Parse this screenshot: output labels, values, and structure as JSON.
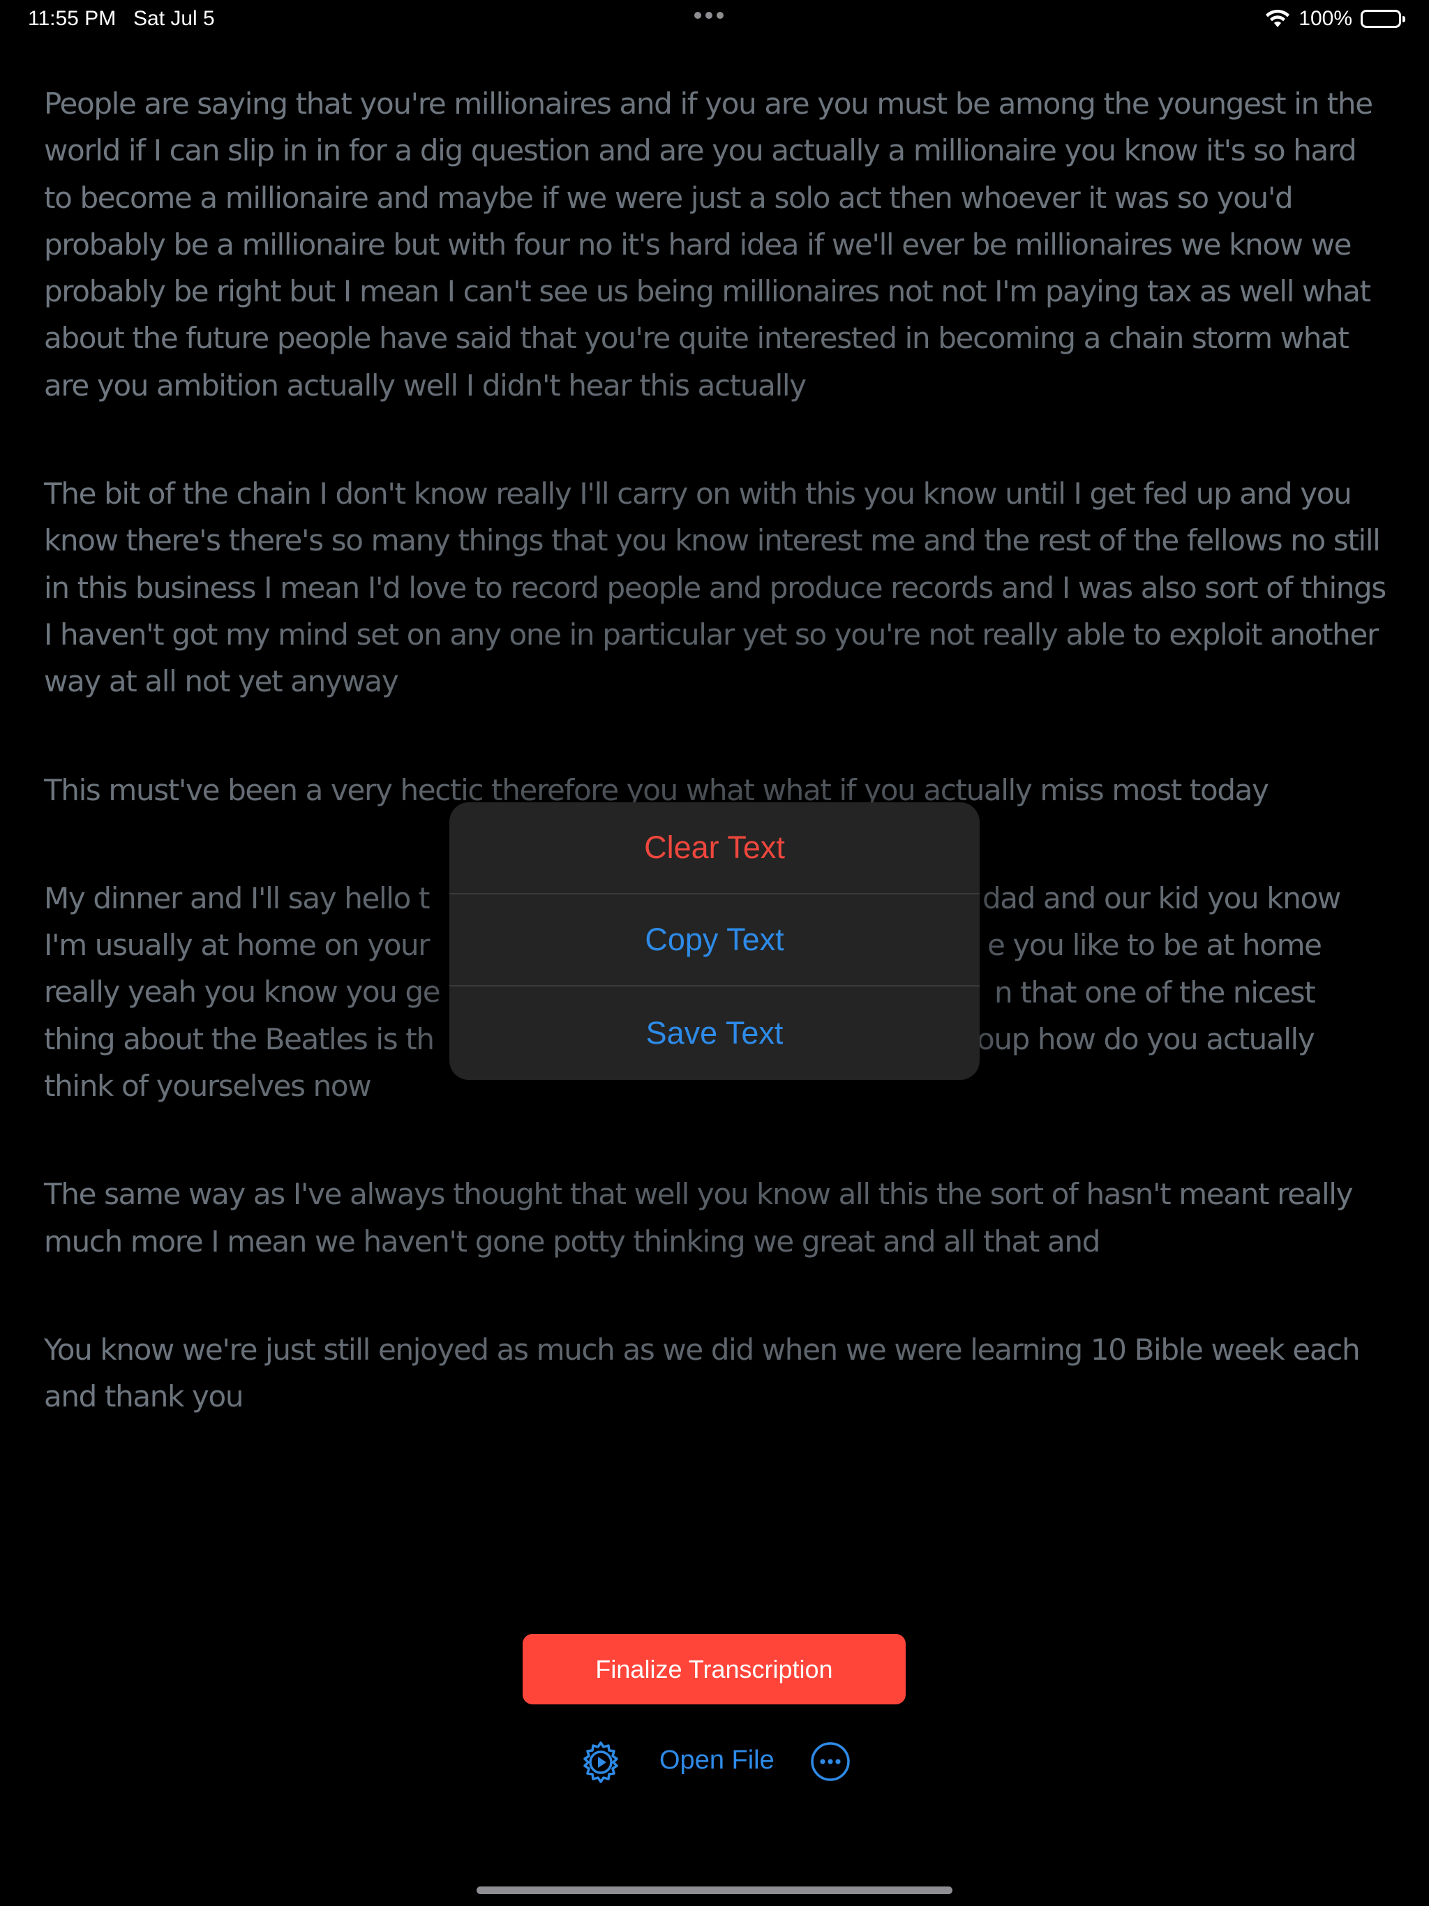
{
  "status_bar": {
    "time": "11:55 PM",
    "date": "Sat Jul 5",
    "battery": "100%",
    "wifi_icon": "wifi-icon",
    "battery_icon": "battery-full-icon"
  },
  "transcript": {
    "paragraphs": [
      "People are saying that you're millionaires and if you are you must be among the youngest in the world if I can slip in in for a dig question and are you actually a millionaire you know it's so hard to become a millionaire and maybe if we were just a solo act then whoever it was so you'd probably be a millionaire but with four no it's hard idea if we'll ever be millionaires we know we probably be right but I mean I can't see us being millionaires not not I'm paying tax as well what about the future people have said that you're quite interested in becoming a chain storm what are you ambition actually well I didn't hear this actually",
      " The bit of the chain I don't know really I'll carry on with this you know until I get fed up and you know there's there's so many things that you know interest me and the rest of the fellows no still in this business I mean I'd love to record people and produce records and I was also sort of things I haven't got my mind set on any one in particular yet so you're not really able to exploit another way at all not yet anyway",
      " This must've been a very hectic therefore you what what if you actually miss most today",
      " My dinner and I'll say hello t",
      " The same way as I've always thought that well you know all this the sort of hasn't meant really much more I mean we haven't gone potty thinking we great and all that and",
      " You know we're just still enjoyed as much as we did when we were learning 10 Bible week each and thank you"
    ],
    "paragraph_4_visible_fragments": [
      " My dinner and I'll say hello t",
      "dad and our kid you know",
      "I'm usually at home on your",
      "e you like to be at home",
      "really yeah you know you ge",
      "n that one of the nicest",
      "thing about the Beatles is th",
      "oup how do you actually",
      "think of yourselves now"
    ]
  },
  "popover": {
    "items": [
      {
        "label": "Clear Text",
        "style": "destructive"
      },
      {
        "label": "Copy Text",
        "style": "normal"
      },
      {
        "label": "Save Text",
        "style": "normal"
      }
    ]
  },
  "controls": {
    "finalize_label": "Finalize Transcription",
    "open_file_label": "Open File",
    "settings_icon": "settings-gear-play-icon",
    "more_icon": "more-ellipsis-icon"
  },
  "colors": {
    "accent_blue": "#2e8be8",
    "destructive_red": "#ef473d",
    "finalize_red": "#ff453a",
    "text_gray": "#6f7780"
  }
}
